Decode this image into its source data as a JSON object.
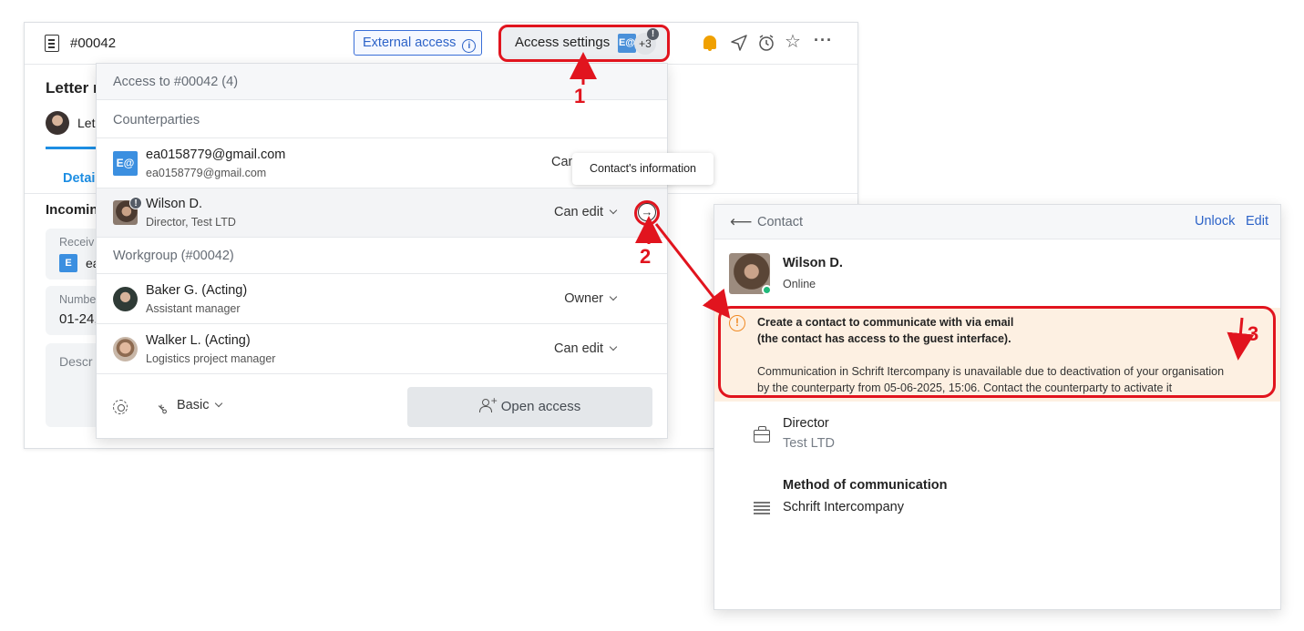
{
  "toolbar": {
    "doc_number": "#00042",
    "external_access_label": "External access",
    "access_settings_label": "Access settings",
    "access_badge": "E@",
    "access_count": "+3",
    "alert_glyph": "!"
  },
  "document": {
    "title_partial": "Letter r",
    "author_partial": "Let",
    "tab_details_partial": "Detai",
    "incoming_partial": "Incomin",
    "received_label_partial": "Receiv",
    "received_badge": "E",
    "received_value_partial": "ea",
    "number_label_partial": "Numbe",
    "number_value_partial": "01-24,",
    "description_label_partial": "Descr"
  },
  "access_panel": {
    "header": "Access to #00042 (4)",
    "counterparties_label": "Counterparties",
    "workgroup_label": "Workgroup (#00042)",
    "counterparties": [
      {
        "avatar": "E@",
        "name": "ea0158779@gmail.com",
        "subtitle": "ea0158779@gmail.com",
        "permission": "Can"
      },
      {
        "name": "Wilson D.",
        "subtitle": "Director, Test LTD",
        "permission": "Can edit"
      }
    ],
    "workgroup": [
      {
        "name": "Baker G. (Acting)",
        "subtitle": "Assistant manager",
        "permission": "Owner"
      },
      {
        "name": "Walker L. (Acting)",
        "subtitle": "Logistics project manager",
        "permission": "Can edit"
      }
    ],
    "footer": {
      "mode_label": "Basic",
      "open_access_label": "Open access",
      "plus_glyph": "+"
    }
  },
  "tooltip": {
    "text": "Contact's information"
  },
  "contact_panel": {
    "title": "Contact",
    "unlock_label": "Unlock",
    "edit_label": "Edit",
    "name": "Wilson D.",
    "status": "Online",
    "warning": {
      "icon_glyph": "!",
      "title_line1": "Create a contact to communicate with via email",
      "title_line2": "(the contact has access to the guest interface).",
      "body_line1": "Communication in Schrift Itercompany is unavailable due to deactivation of your organisation",
      "body_line2": "by the counterparty from 05-06-2025, 15:06. Contact the counterparty to activate it"
    },
    "position": "Director",
    "company": "Test LTD",
    "method_title": "Method of communication",
    "method_value": "Schrift Intercompany"
  },
  "annotations": {
    "step1": "1",
    "step2": "2",
    "step3": "3",
    "color": "#e1141e"
  },
  "colors": {
    "accent_blue": "#1d8ee3",
    "link_blue": "#2d63c8",
    "warning_bg": "#fdf0e2",
    "warning_orange": "#f08a24",
    "online_green": "#20b97a",
    "bell_orange": "#f0a000"
  }
}
